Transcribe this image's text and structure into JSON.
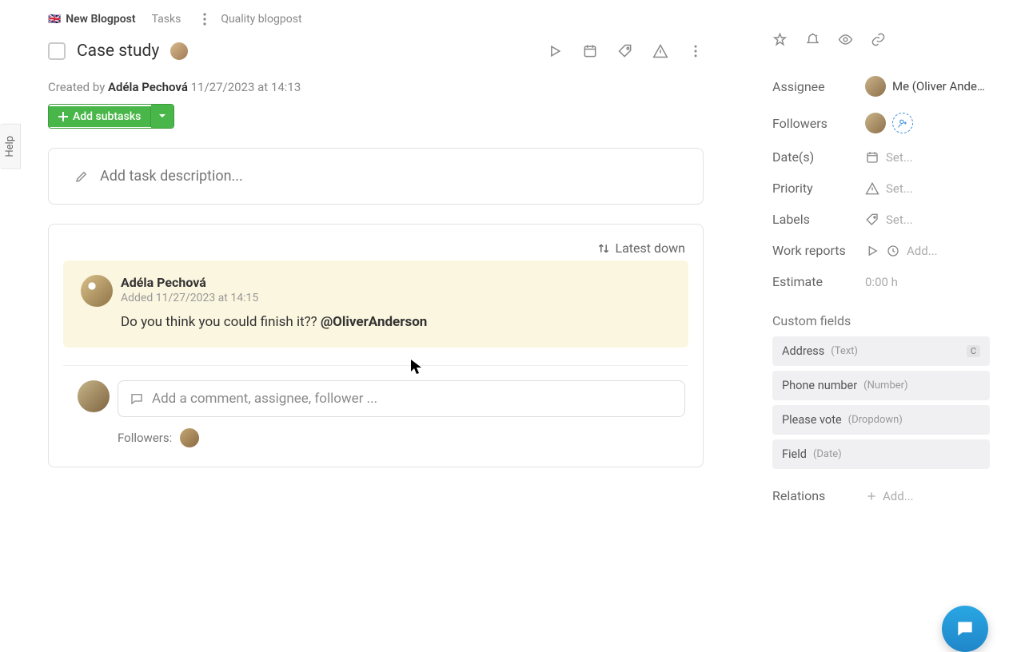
{
  "help_tab": "Help",
  "breadcrumb": {
    "flag": "🇬🇧",
    "project": "New Blogpost",
    "tasks": "Tasks",
    "current": "Quality blogpost"
  },
  "title": "Case study",
  "created": {
    "prefix": "Created by ",
    "who": "Adéla Pechová",
    "when": " 11/27/2023 at 14:13"
  },
  "add_subtasks": "Add subtasks",
  "description_placeholder": "Add task description...",
  "sort_label": "Latest down",
  "comment": {
    "author": "Adéla Pechová",
    "meta": "Added 11/27/2023 at 14:15",
    "text": "Do you think you could finish it?? ",
    "mention": "@OliverAnderson"
  },
  "comment_input_placeholder": "Add a comment, assignee, follower ...",
  "followers_label": "Followers:",
  "sidebar": {
    "assignee": {
      "label": "Assignee",
      "value": "Me (Oliver Ande…"
    },
    "followers": {
      "label": "Followers"
    },
    "dates": {
      "label": "Date(s)",
      "value": "Set..."
    },
    "priority": {
      "label": "Priority",
      "value": "Set..."
    },
    "labels": {
      "label": "Labels",
      "value": "Set..."
    },
    "work": {
      "label": "Work reports",
      "value": "Add..."
    },
    "estimate": {
      "label": "Estimate",
      "value": "0:00 h"
    },
    "custom_title": "Custom fields",
    "cf": [
      {
        "name": "Address",
        "type": "(Text)",
        "kbd": "C"
      },
      {
        "name": "Phone number",
        "type": "(Number)"
      },
      {
        "name": "Please vote",
        "type": "(Dropdown)"
      },
      {
        "name": "Field",
        "type": "(Date)"
      }
    ],
    "relations": {
      "label": "Relations",
      "value": "Add..."
    }
  }
}
